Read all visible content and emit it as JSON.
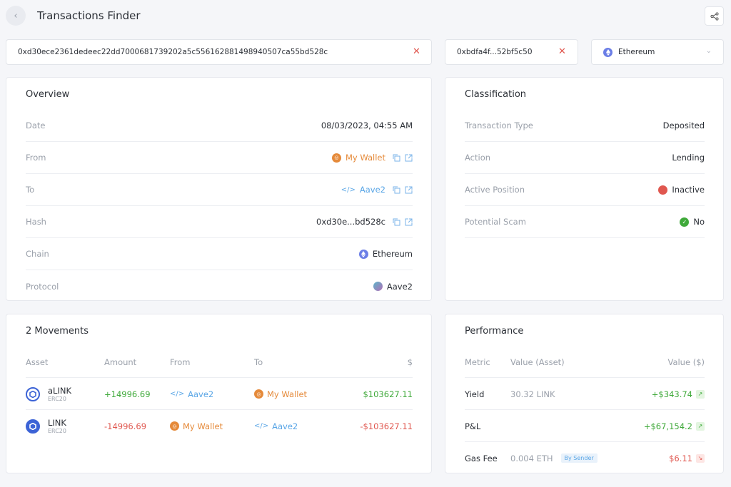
{
  "header": {
    "title": "Transactions Finder"
  },
  "search": {
    "hash_value": "0xd30ece2361dedeec22dd7000681739202a5c55616288149894050​7ca55bd528c",
    "address_value": "0xbdfa4f...52bf5c50",
    "chain_selected": "Ethereum"
  },
  "overview": {
    "title": "Overview",
    "rows": [
      {
        "label": "Date",
        "value": "08/03/2023, 04:55 AM"
      },
      {
        "label": "From",
        "value": "My Wallet"
      },
      {
        "label": "To",
        "value": "Aave2"
      },
      {
        "label": "Hash",
        "value": "0xd30e...bd528c"
      },
      {
        "label": "Chain",
        "value": "Ethereum"
      },
      {
        "label": "Protocol",
        "value": "Aave2"
      }
    ]
  },
  "classification": {
    "title": "Classification",
    "rows": [
      {
        "label": "Transaction Type",
        "value": "Deposited"
      },
      {
        "label": "Action",
        "value": "Lending"
      },
      {
        "label": "Active Position",
        "value": "Inactive"
      },
      {
        "label": "Potential Scam",
        "value": "No"
      }
    ]
  },
  "movements": {
    "title": "2 Movements",
    "headers": {
      "asset": "Asset",
      "amount": "Amount",
      "from": "From",
      "to": "To",
      "usd": "$"
    },
    "rows": [
      {
        "asset": "aLINK",
        "standard": "ERC20",
        "amount": "+14996.69",
        "from": "Aave2",
        "to": "My Wallet",
        "usd": "$103627.11"
      },
      {
        "asset": "LINK",
        "standard": "ERC20",
        "amount": "-14996.69",
        "from": "My Wallet",
        "to": "Aave2",
        "usd": "-$103627.11"
      }
    ]
  },
  "performance": {
    "title": "Performance",
    "headers": {
      "metric": "Metric",
      "value_asset": "Value (Asset)",
      "value_usd": "Value ($)"
    },
    "rows": [
      {
        "metric": "Yield",
        "value_asset": "30.32 LINK",
        "value_usd": "+$343.74"
      },
      {
        "metric": "P&L",
        "value_asset": "",
        "value_usd": "+$67,154.2"
      },
      {
        "metric": "Gas Fee",
        "value_asset": "0.004 ETH",
        "tag": "By Sender",
        "value_usd": "$6.11"
      }
    ]
  },
  "colors": {
    "accent_orange": "#e58a3a",
    "accent_blue": "#5aa6e6",
    "positive": "#3fa93a",
    "negative": "#e0574f"
  }
}
